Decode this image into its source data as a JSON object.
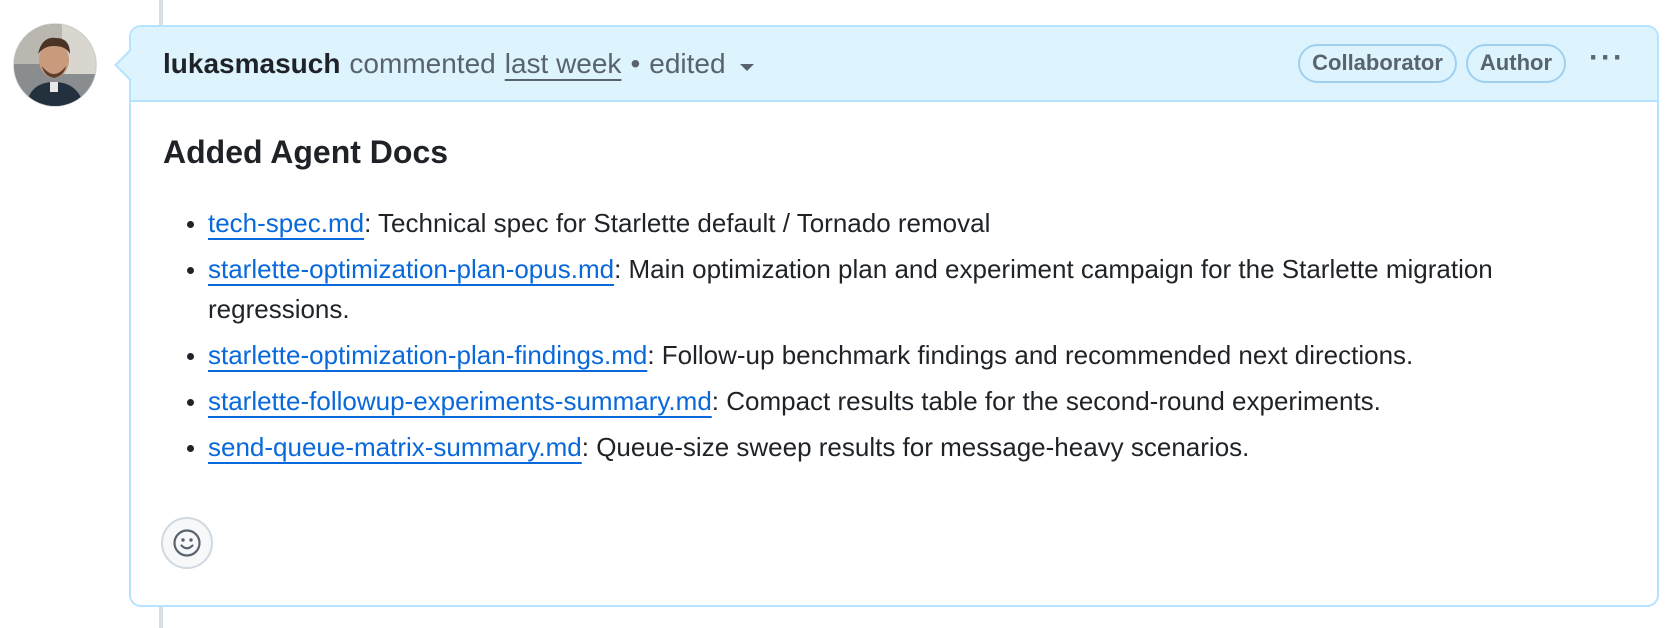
{
  "comment": {
    "author": "lukasmasuch",
    "action": "commented",
    "time": "last week",
    "dot": "•",
    "edited": "edited",
    "badges": [
      "Collaborator",
      "Author"
    ],
    "menu_icon": "kebab-horizontal-icon",
    "title": "Added Agent Docs",
    "docs": [
      {
        "file": "tech-spec.md",
        "desc": ": Technical spec for Starlette default / Tornado removal"
      },
      {
        "file": "starlette-optimization-plan-opus.md",
        "desc": ": Main optimization plan and experiment campaign for the Starlette migration regressions."
      },
      {
        "file": "starlette-optimization-plan-findings.md",
        "desc": ": Follow-up benchmark findings and recommended next directions."
      },
      {
        "file": "starlette-followup-experiments-summary.md",
        "desc": ": Compact results table for the second-round experiments."
      },
      {
        "file": "send-queue-matrix-summary.md",
        "desc": ": Queue-size sweep results for message-heavy scenarios."
      }
    ],
    "reaction_icon": "smiley-icon"
  },
  "colors": {
    "header_bg": "#ddf4ff",
    "border": "#b6e3ff",
    "link": "#0969da",
    "muted": "#59636e",
    "text": "#1f2328"
  }
}
